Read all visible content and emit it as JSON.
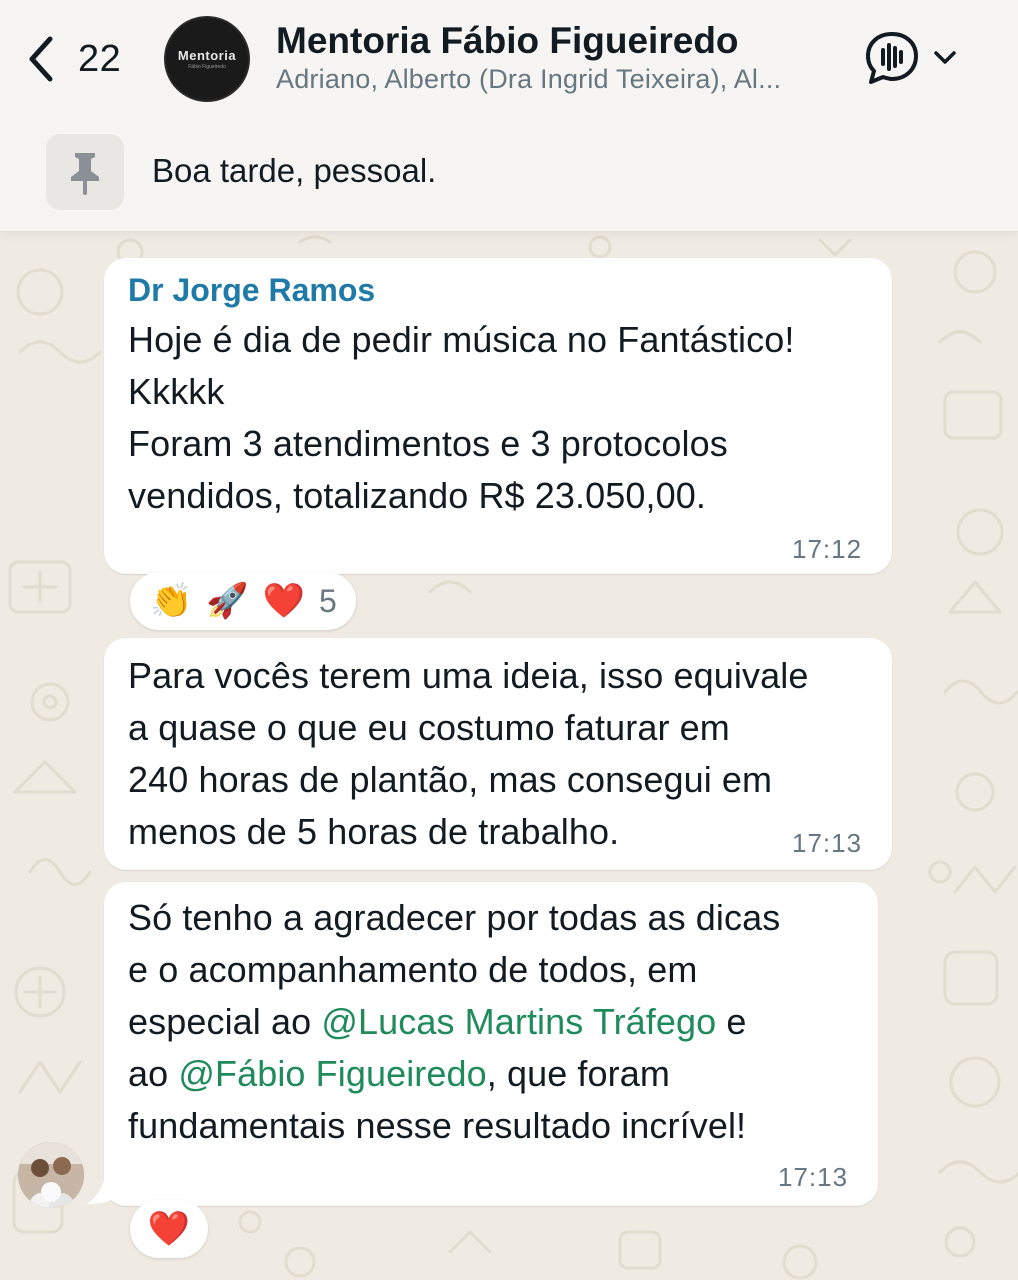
{
  "header": {
    "back_count": "22",
    "group_avatar_logo": "Mentoria",
    "group_avatar_sub": "Fábio Figueiredo",
    "title": "Mentoria Fábio Figueiredo",
    "members": "Adriano, Alberto (Dra Ingrid Teixeira), Al..."
  },
  "pinned": {
    "icon": "pin-icon",
    "text": "Boa tarde, pessoal."
  },
  "messages": [
    {
      "sender": "Dr Jorge Ramos",
      "text": "Hoje é dia de pedir música no Fantástico!\nKkkkk\nForam 3 atendimentos e 3 protocolos\nvendidos, totalizando R$ 23.050,00.",
      "time": "17:12",
      "reactions": {
        "emojis": [
          "👏",
          "🚀",
          "❤️"
        ],
        "count": "5"
      }
    },
    {
      "text": "Para vocês terem uma ideia, isso equivale\na quase o que eu costumo faturar em\n240 horas de plantão, mas consegui em\nmenos de 5 horas de trabalho.",
      "time": "17:13"
    },
    {
      "text_line1": "Só tenho a agradecer por todas as dicas",
      "text_line2": "e o acompanhamento de todos, em",
      "text_line3_pre": "especial ao ",
      "mention1": "@Lucas Martins Tráfego",
      "text_line3_post": " e",
      "text_line4_pre": "ao ",
      "mention2": "@Fábio Figueiredo",
      "text_line4_post": ", que foram",
      "text_line5": "fundamentais nesse resultado incrível!",
      "time": "17:13",
      "reactions": {
        "emojis": [
          "❤️"
        ]
      }
    }
  ],
  "colors": {
    "chat_background": "#efeae2",
    "sender_name": "#1f7aa8",
    "mention": "#1f8a5c",
    "bubble": "#ffffff",
    "time": "#667781"
  }
}
